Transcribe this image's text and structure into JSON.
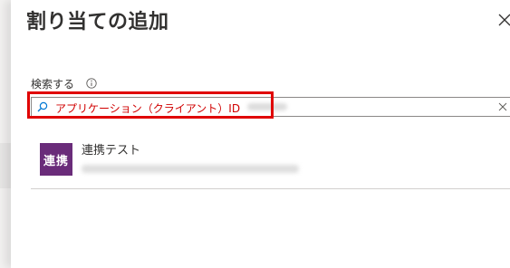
{
  "panel": {
    "title": "割り当ての追加",
    "close_icon": "close-icon"
  },
  "search": {
    "label": "検索する",
    "info_icon": "info-icon",
    "value": "アプリケーション（クライアント）ID",
    "search_icon": "search-icon",
    "clear_icon": "clear-icon"
  },
  "results": [
    {
      "tile_label": "連携",
      "name": "連携テスト",
      "tile_color": "#6a2c7a"
    }
  ],
  "colors": {
    "highlight": "#e00000",
    "tile": "#6a2c7a"
  }
}
